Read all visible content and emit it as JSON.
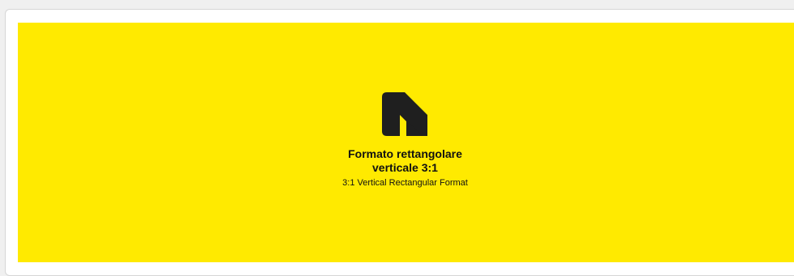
{
  "banner": {
    "background": "#ffea00",
    "logo_icon": "brand-logo-icon",
    "title_line1": "Formato rettangolare",
    "title_line2": "verticale 3:1",
    "subtitle": "3:1 Vertical Rectangular Format"
  }
}
